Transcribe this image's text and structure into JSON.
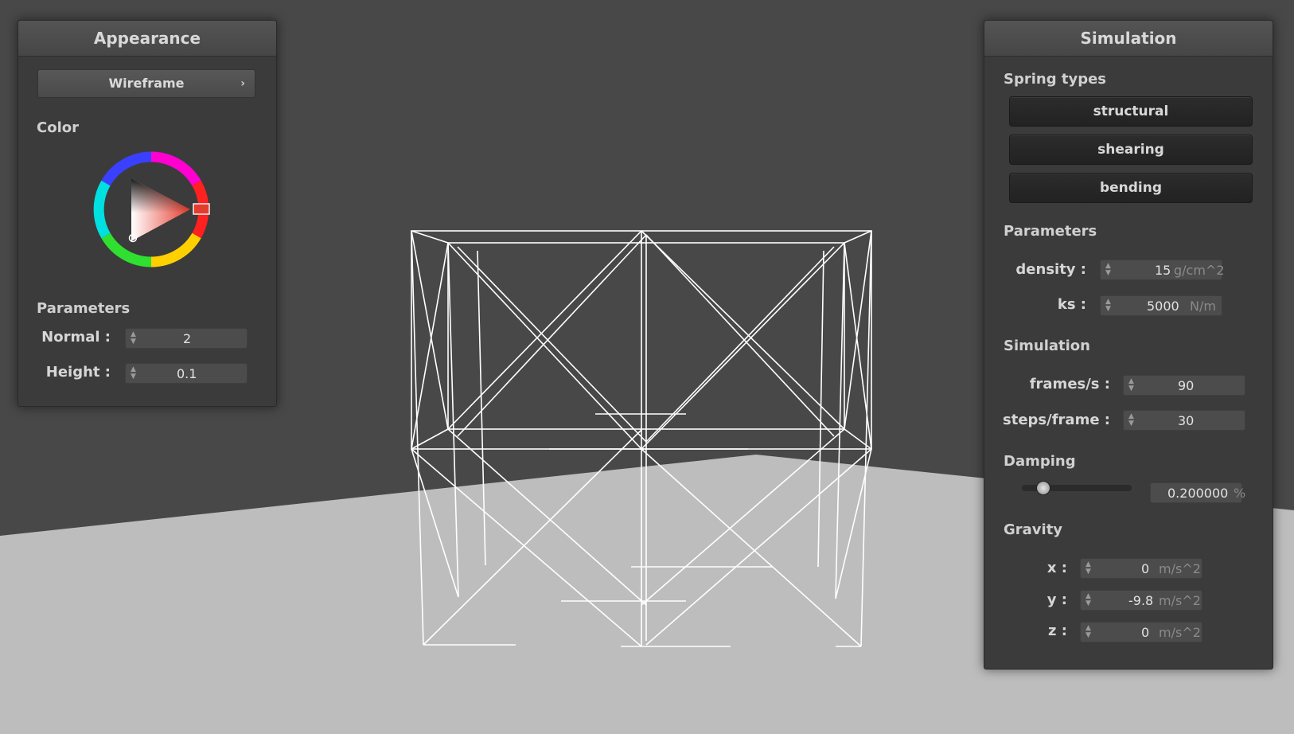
{
  "appearance": {
    "title": "Appearance",
    "mode": "Wireframe",
    "color_label": "Color",
    "parameters_label": "Parameters",
    "normal": {
      "label": "Normal :",
      "value": "2"
    },
    "height": {
      "label": "Height :",
      "value": "0.1"
    }
  },
  "simulation": {
    "title": "Simulation",
    "spring_types_label": "Spring types",
    "springs": [
      "structural",
      "shearing",
      "bending"
    ],
    "parameters_label": "Parameters",
    "density": {
      "label": "density :",
      "value": "15",
      "unit": "g/cm^2"
    },
    "ks": {
      "label": "ks :",
      "value": "5000",
      "unit": "N/m"
    },
    "simulation_label": "Simulation",
    "fps": {
      "label": "frames/s :",
      "value": "90"
    },
    "steps": {
      "label": "steps/frame :",
      "value": "30"
    },
    "damping_label": "Damping",
    "damping": {
      "value": "0.200000",
      "unit": "%",
      "level": 0.2
    },
    "gravity_label": "Gravity",
    "gravity": {
      "x": {
        "label": "x :",
        "value": "0",
        "unit": "m/s^2"
      },
      "y": {
        "label": "y :",
        "value": "-9.8",
        "unit": "m/s^2"
      },
      "z": {
        "label": "z :",
        "value": "0",
        "unit": "m/s^2"
      }
    }
  },
  "colors": {
    "background": "#484848",
    "floor": "#bdbdbd",
    "wireframe": "#ffffff",
    "picked_color": "#e63c2d"
  }
}
